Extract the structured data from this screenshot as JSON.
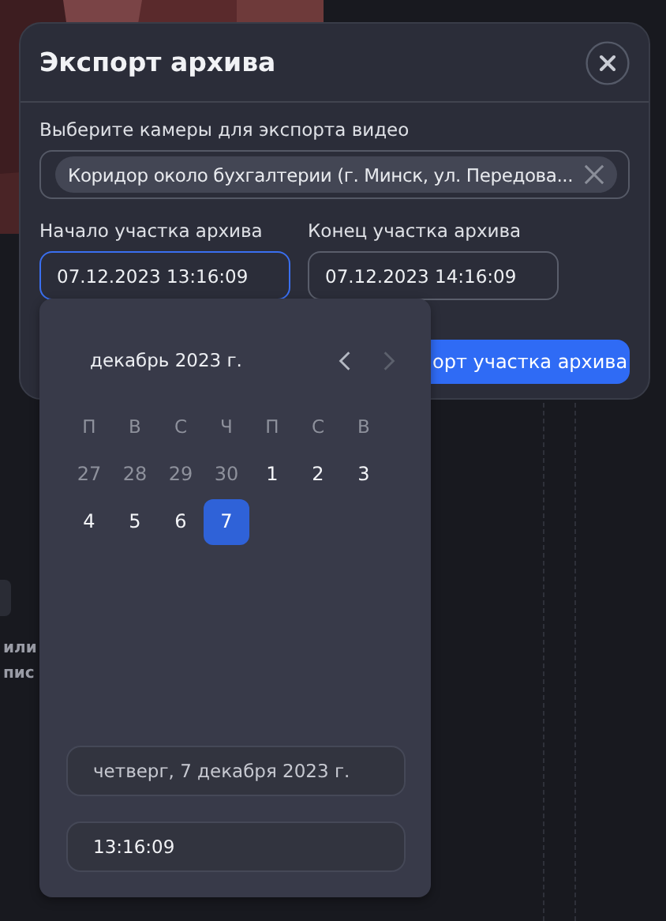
{
  "background": {
    "texts": [
      "или",
      "пис"
    ]
  },
  "dialog": {
    "title": "Экспорт архива",
    "camera_label": "Выберите камеры для экспорта видео",
    "cameras": [
      {
        "label": "Коридор около бухгалтерии (г. Минск, ул. Передова..."
      }
    ],
    "fields": [
      {
        "label": "Начало участка архива",
        "value": "07.12.2023 13:16:09",
        "focused": true
      },
      {
        "label": "Конец участка архива",
        "value": "07.12.2023 14:16:09",
        "focused": false
      }
    ],
    "export_button": "орт участка архива"
  },
  "calendar": {
    "month": "декабрь 2023 г.",
    "prev_enabled": true,
    "next_enabled": false,
    "weekdays": [
      "П",
      "В",
      "С",
      "Ч",
      "П",
      "С",
      "В"
    ],
    "days": [
      {
        "label": "27",
        "outside": true,
        "selected": false
      },
      {
        "label": "28",
        "outside": true,
        "selected": false
      },
      {
        "label": "29",
        "outside": true,
        "selected": false
      },
      {
        "label": "30",
        "outside": true,
        "selected": false
      },
      {
        "label": "1",
        "outside": false,
        "selected": false
      },
      {
        "label": "2",
        "outside": false,
        "selected": false
      },
      {
        "label": "3",
        "outside": false,
        "selected": false
      },
      {
        "label": "4",
        "outside": false,
        "selected": false
      },
      {
        "label": "5",
        "outside": false,
        "selected": false
      },
      {
        "label": "6",
        "outside": false,
        "selected": false
      },
      {
        "label": "7",
        "outside": false,
        "selected": true
      }
    ],
    "date_text": "четверг, 7 декабря 2023 г.",
    "time_value": "13:16:09"
  }
}
